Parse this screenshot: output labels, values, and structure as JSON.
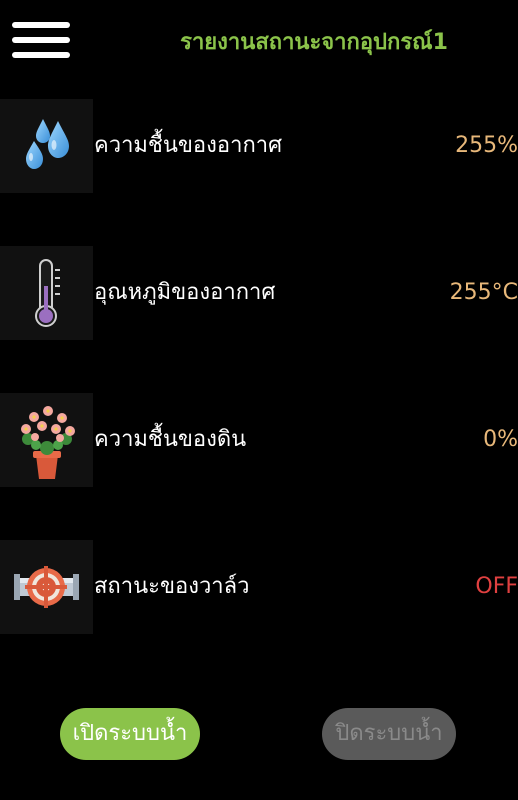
{
  "header": {
    "title": "รายงานสถานะจากอุปกรณ์1",
    "menu_icon": "hamburger-menu-icon"
  },
  "rows": [
    {
      "icon": "water-drops-icon",
      "label": "ความชื้นของอากาศ",
      "value": "255%"
    },
    {
      "icon": "thermometer-icon",
      "label": "อุณหภูมิของอากาศ",
      "value": "255°C"
    },
    {
      "icon": "flower-pot-icon",
      "label": "ความชื้นของดิน",
      "value": "0%"
    },
    {
      "icon": "valve-icon",
      "label": "สถานะของวาล์ว",
      "value": "OFF"
    }
  ],
  "buttons": {
    "turn_on_label": "เปิดระบบน้ำ",
    "turn_off_label": "ปิดระบบน้ำ"
  },
  "colors": {
    "background": "#000000",
    "accent_green": "#8bc34a",
    "value_orange": "#e8b87a",
    "status_off_red": "#e04040",
    "disabled_button": "#5a5a5a"
  }
}
